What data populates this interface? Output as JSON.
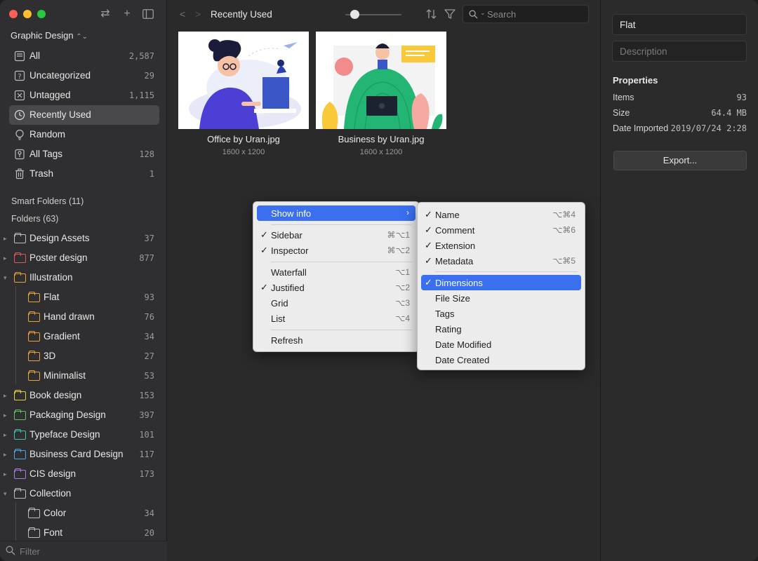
{
  "sidebar": {
    "library_name": "Graphic Design",
    "items": [
      {
        "label": "All",
        "count": "2,587"
      },
      {
        "label": "Uncategorized",
        "count": "29"
      },
      {
        "label": "Untagged",
        "count": "1,115"
      },
      {
        "label": "Recently Used",
        "count": ""
      },
      {
        "label": "Random",
        "count": ""
      },
      {
        "label": "All Tags",
        "count": "128"
      },
      {
        "label": "Trash",
        "count": "1"
      }
    ],
    "smart_folders_label": "Smart Folders (11)",
    "folders_label": "Folders (63)",
    "folders": [
      {
        "label": "Design Assets",
        "count": "37",
        "color": "#bdbdbd"
      },
      {
        "label": "Poster design",
        "count": "877",
        "color": "#e0565b"
      },
      {
        "label": "Illustration",
        "count": "",
        "color": "#e8a23a"
      },
      {
        "label": "Flat",
        "count": "93",
        "color": "#e8a23a"
      },
      {
        "label": "Hand drawn",
        "count": "76",
        "color": "#e8a23a"
      },
      {
        "label": "Gradient",
        "count": "34",
        "color": "#e8a23a"
      },
      {
        "label": "3D",
        "count": "27",
        "color": "#e8a23a"
      },
      {
        "label": "Minimalist",
        "count": "53",
        "color": "#e8a23a"
      },
      {
        "label": "Book design",
        "count": "153",
        "color": "#e8d23a"
      },
      {
        "label": "Packaging Design",
        "count": "397",
        "color": "#5cc25c"
      },
      {
        "label": "Typeface Design",
        "count": "101",
        "color": "#3fc4b0"
      },
      {
        "label": "Business Card Design",
        "count": "117",
        "color": "#4aa8e8"
      },
      {
        "label": "CIS design",
        "count": "173",
        "color": "#b07ae0"
      },
      {
        "label": "Collection",
        "count": "",
        "color": "#bdbdbd"
      },
      {
        "label": "Color",
        "count": "34",
        "color": "#bdbdbd"
      },
      {
        "label": "Font",
        "count": "20",
        "color": "#bdbdbd"
      }
    ],
    "filter_placeholder": "Filter"
  },
  "toolbar": {
    "title": "Recently Used",
    "search_placeholder": "Search",
    "zoom_level": 0.1
  },
  "items": [
    {
      "name": "Office by Uran.jpg",
      "dimensions": "1600 x 1200"
    },
    {
      "name": "Business by Uran.jpg",
      "dimensions": "1600 x 1200"
    }
  ],
  "context_menu": {
    "items": [
      {
        "label": "Show info",
        "shortcut": "",
        "checked": false
      },
      {
        "label": "Sidebar",
        "shortcut": "⌘⌥1",
        "checked": true
      },
      {
        "label": "Inspector",
        "shortcut": "⌘⌥2",
        "checked": true
      },
      {
        "label": "Waterfall",
        "shortcut": "⌥1",
        "checked": false
      },
      {
        "label": "Justified",
        "shortcut": "⌥2",
        "checked": true
      },
      {
        "label": "Grid",
        "shortcut": "⌥3",
        "checked": false
      },
      {
        "label": "List",
        "shortcut": "⌥4",
        "checked": false
      },
      {
        "label": "Refresh",
        "shortcut": "",
        "checked": false
      }
    ]
  },
  "submenu": {
    "items": [
      {
        "label": "Name",
        "shortcut": "⌥⌘4",
        "checked": true
      },
      {
        "label": "Comment",
        "shortcut": "⌥⌘6",
        "checked": true
      },
      {
        "label": "Extension",
        "shortcut": "",
        "checked": true
      },
      {
        "label": "Metadata",
        "shortcut": "⌥⌘5",
        "checked": true
      },
      {
        "label": "Dimensions",
        "shortcut": "",
        "checked": true
      },
      {
        "label": "File Size",
        "shortcut": "",
        "checked": false
      },
      {
        "label": "Tags",
        "shortcut": "",
        "checked": false
      },
      {
        "label": "Rating",
        "shortcut": "",
        "checked": false
      },
      {
        "label": "Date Modified",
        "shortcut": "",
        "checked": false
      },
      {
        "label": "Date Created",
        "shortcut": "",
        "checked": false
      }
    ]
  },
  "inspector": {
    "name_value": "Flat",
    "description_placeholder": "Description",
    "properties_heading": "Properties",
    "properties": [
      {
        "label": "Items",
        "value": "93"
      },
      {
        "label": "Size",
        "value": "64.4 MB"
      },
      {
        "label": "Date Imported",
        "value": "2019/07/24 2:28"
      }
    ],
    "export_label": "Export..."
  },
  "colors": {
    "accent": "#3a6ff0",
    "sidebar_bg": "#2f2f31",
    "main_bg": "#2a2a2a"
  }
}
